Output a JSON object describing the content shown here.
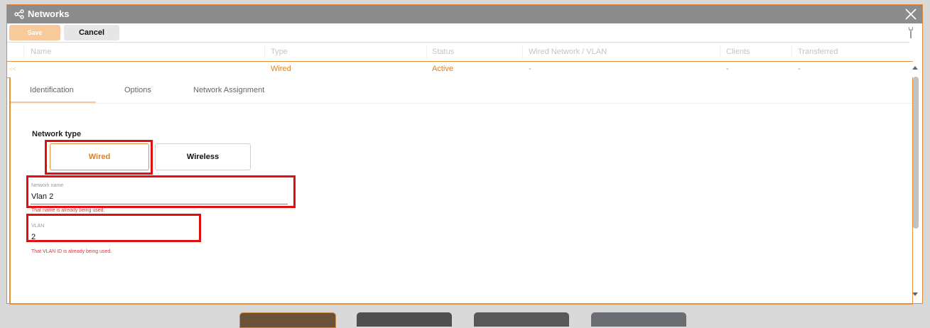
{
  "window": {
    "title": "Networks",
    "title_icon": "share-nodes-icon",
    "close_icon": "close-icon"
  },
  "toolbar": {
    "save_label": "Save",
    "cancel_label": "Cancel",
    "tools_icon": "wrench-icon"
  },
  "grid": {
    "columns": [
      "Name",
      "Type",
      "Status",
      "Wired Network / VLAN",
      "Clients",
      "Transferred"
    ],
    "row": {
      "marker": "<<",
      "name": "",
      "type": "Wired",
      "status": "Active",
      "wired_vlan": "-",
      "clients": "-",
      "transferred": "-"
    }
  },
  "tabs": [
    "Identification",
    "Options",
    "Network Assignment"
  ],
  "form": {
    "network_type_label": "Network type",
    "network_type_options": [
      "Wired",
      "Wireless"
    ],
    "network_type_selected": "Wired",
    "network_name": {
      "label": "Network name",
      "value": "Vlan 2",
      "error": "That name is already being used."
    },
    "vlan": {
      "label": "VLAN",
      "value": "2",
      "error": "That VLAN ID is already being used."
    }
  },
  "colors": {
    "accent": "#e8913c",
    "accent_text": "#e07f22",
    "highlight": "#e01010",
    "error": "#d9363e",
    "titlebar": "#8c8c8c"
  }
}
